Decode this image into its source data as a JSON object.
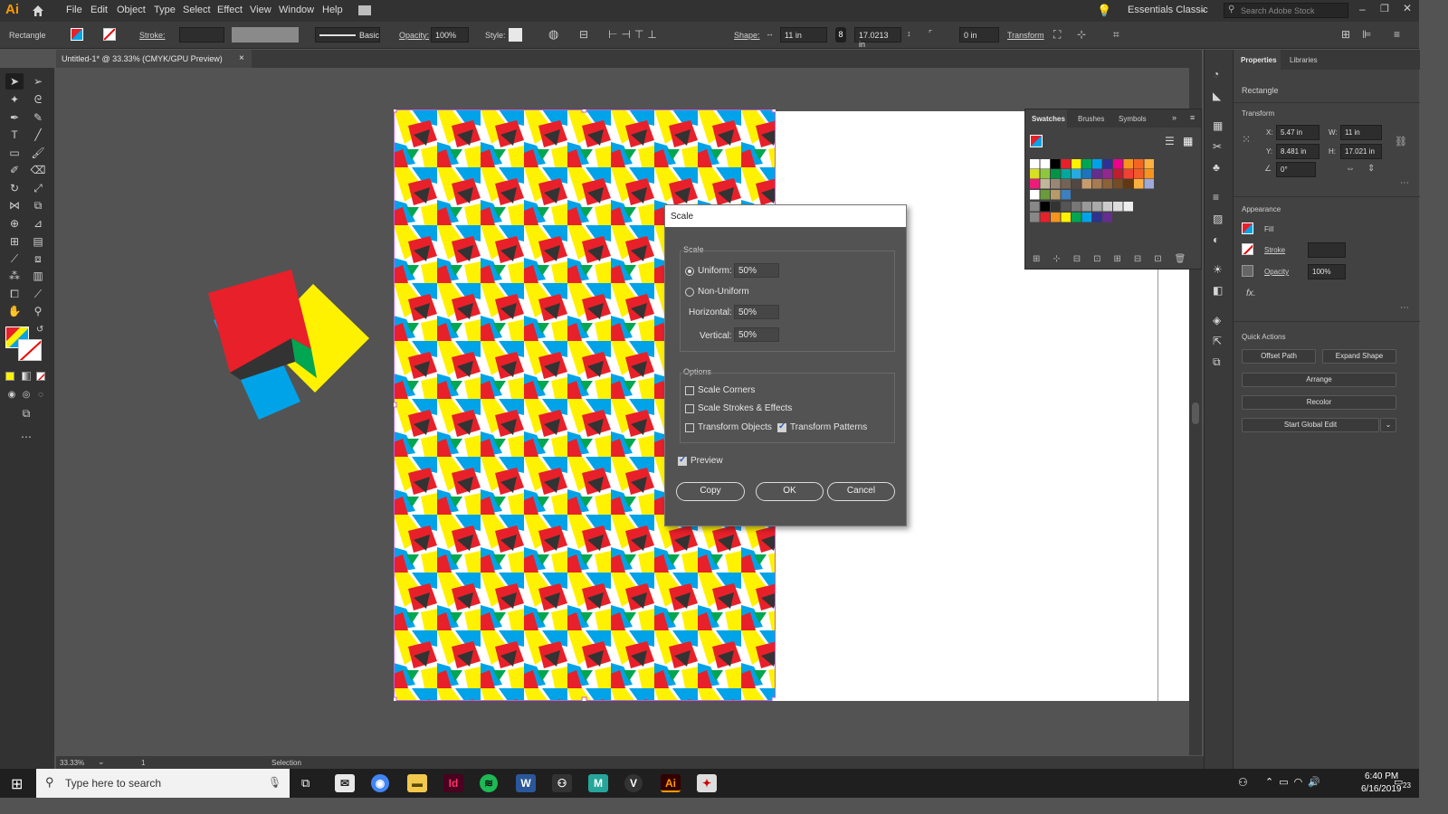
{
  "app": {
    "logo": "Ai",
    "title": "Untitled-1* @ 33.33% (CMYK/GPU Preview)",
    "tab_close": "×"
  },
  "menu": [
    "File",
    "Edit",
    "Object",
    "Type",
    "Select",
    "Effect",
    "View",
    "Window",
    "Help"
  ],
  "workspace": "Essentials Classic",
  "stock_search_placeholder": "Search Adobe Stock",
  "control": {
    "object_type": "Rectangle",
    "stroke_label": "Stroke:",
    "brush": "Basic",
    "opacity_label": "Opacity:",
    "opacity": "100%",
    "style_label": "Style:",
    "shape_label": "Shape:",
    "width": "11 in",
    "height": "17.0213 in",
    "corner": "0 in",
    "transform_label": "Transform"
  },
  "dialog": {
    "title": "Scale",
    "scale_group": "Scale",
    "uniform_label": "Uniform:",
    "uniform_value": "50%",
    "non_uniform_label": "Non-Uniform",
    "horizontal_label": "Horizontal:",
    "horizontal_value": "50%",
    "vertical_label": "Vertical:",
    "vertical_value": "50%",
    "options_group": "Options",
    "scale_corners": "Scale Corners",
    "scale_strokes": "Scale Strokes & Effects",
    "transform_objects": "Transform Objects",
    "transform_patterns": "Transform Patterns",
    "preview": "Preview",
    "copy": "Copy",
    "ok": "OK",
    "cancel": "Cancel"
  },
  "swatches_panel": {
    "tabs": [
      "Swatches",
      "Brushes",
      "Symbols"
    ]
  },
  "properties": {
    "tabs": [
      "Properties",
      "Libraries"
    ],
    "object": "Rectangle",
    "transform": "Transform",
    "x_label": "X:",
    "x": "5.47 in",
    "y_label": "Y:",
    "y": "8.481 in",
    "w_label": "W:",
    "w": "11 in",
    "h_label": "H:",
    "h": "17.021 in",
    "angle": "0°",
    "appearance": "Appearance",
    "fill": "Fill",
    "stroke": "Stroke",
    "opacity_label": "Opacity",
    "opacity": "100%",
    "fx": "fx.",
    "quick_actions": "Quick Actions",
    "offset_path": "Offset Path",
    "expand_shape": "Expand Shape",
    "arrange": "Arrange",
    "recolor": "Recolor",
    "global_edit": "Start Global Edit"
  },
  "status": {
    "zoom": "33.33%",
    "artboard": "1",
    "tool": "Selection"
  },
  "taskbar": {
    "search": "Type here to search",
    "time": "6:40 PM",
    "date": "6/16/2019",
    "notifications": "23"
  },
  "colors": {
    "red": "#e8202a",
    "yellow": "#fff200",
    "blue": "#00a3e8",
    "green": "#00a651",
    "dark": "#333333"
  }
}
